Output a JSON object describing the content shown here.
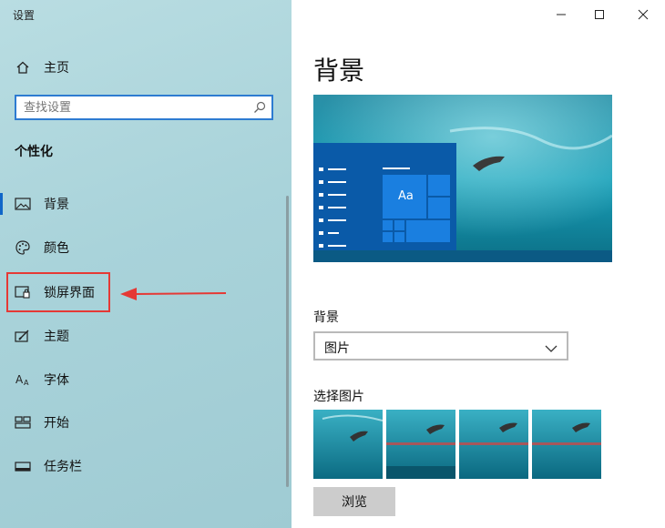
{
  "window": {
    "title": "设置"
  },
  "sidebar": {
    "home_label": "主页",
    "search_placeholder": "查找设置",
    "section_title": "个性化",
    "items": [
      {
        "label": "背景",
        "icon": "picture-icon"
      },
      {
        "label": "颜色",
        "icon": "palette-icon"
      },
      {
        "label": "锁屏界面",
        "icon": "lockscreen-icon"
      },
      {
        "label": "主题",
        "icon": "theme-icon"
      },
      {
        "label": "字体",
        "icon": "font-icon"
      },
      {
        "label": "开始",
        "icon": "start-icon"
      },
      {
        "label": "任务栏",
        "icon": "taskbar-icon"
      }
    ],
    "active_item": "背景",
    "highlighted_item": "锁屏界面"
  },
  "main": {
    "page_title": "背景",
    "preview_tile_label": "Aa",
    "background_label": "背景",
    "background_value": "图片",
    "choose_picture_label": "选择图片",
    "browse_label": "浏览"
  },
  "colors": {
    "accent": "#1066c9",
    "annotation_red": "#e53935",
    "sidebar_bg": "#a9d3da"
  }
}
